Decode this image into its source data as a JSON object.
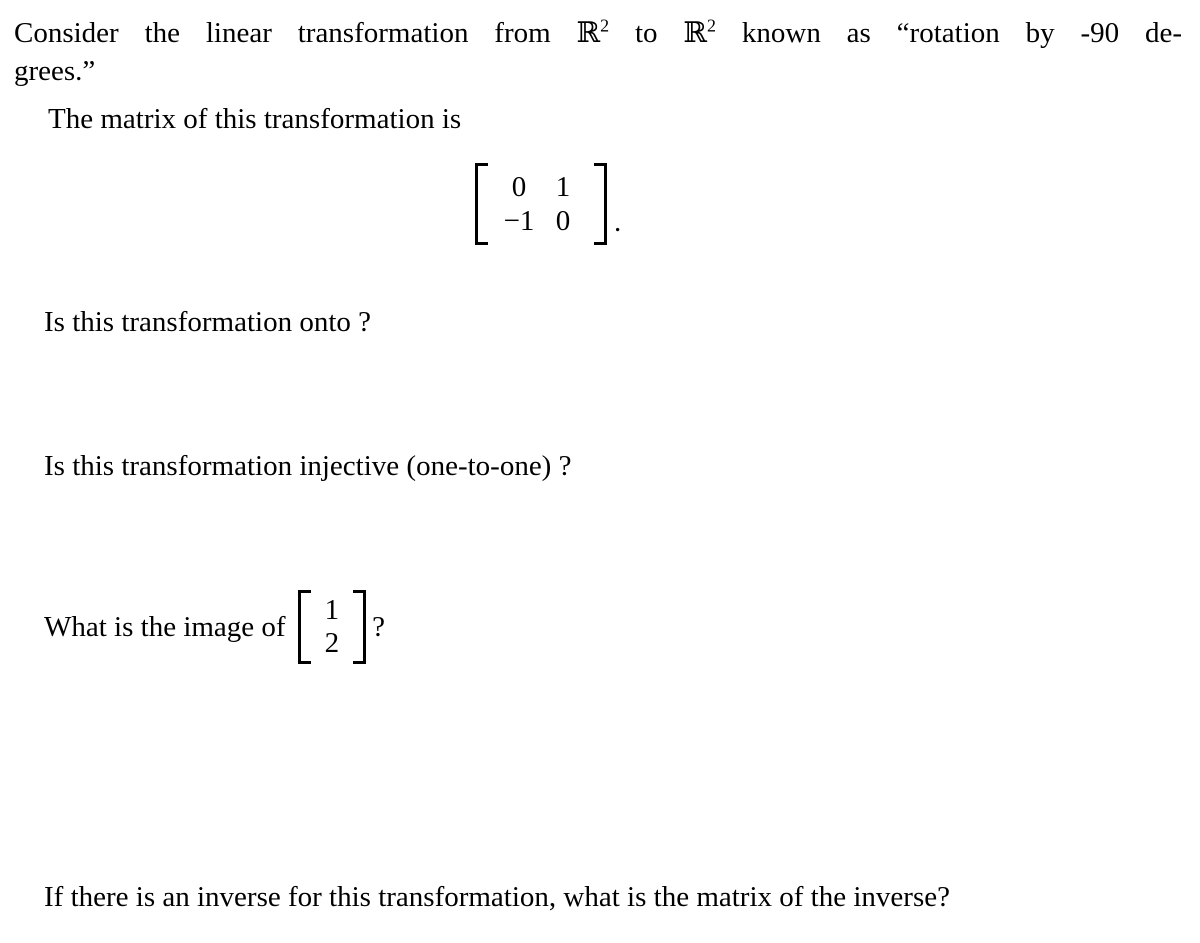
{
  "document": {
    "type": "math-worksheet",
    "background_color": "#ffffff",
    "text_color": "#000000",
    "intro": {
      "line1": "Consider the linear transformation from ℝ2 to ℝ2 known as “rotation by -90 de-",
      "line2": "grees.”",
      "segments": {
        "before_first_R": "Consider the linear transformation from ",
        "R": "ℝ",
        "exp": "2",
        "between_R": " to ",
        "after_second_R": " known as “rotation by -90 de-",
        "hyphen_continuation": "grees.”"
      }
    },
    "matrix_lead_in": "The matrix of this transformation is",
    "transformation_matrix": {
      "rows": [
        [
          "0",
          "1"
        ],
        [
          "−1",
          "0"
        ]
      ],
      "trailing_punctuation": "."
    },
    "questions": [
      {
        "id": "onto",
        "text": "Is this transformation onto ?"
      },
      {
        "id": "injective",
        "text": "Is this transformation injective (one-to-one) ?"
      },
      {
        "id": "image",
        "lead": "What is the image of",
        "vector": [
          "1",
          "2"
        ],
        "trailing_punctuation": "?"
      },
      {
        "id": "inverse",
        "text": "If there is an inverse for this transformation, what is the matrix of the inverse?"
      }
    ]
  }
}
